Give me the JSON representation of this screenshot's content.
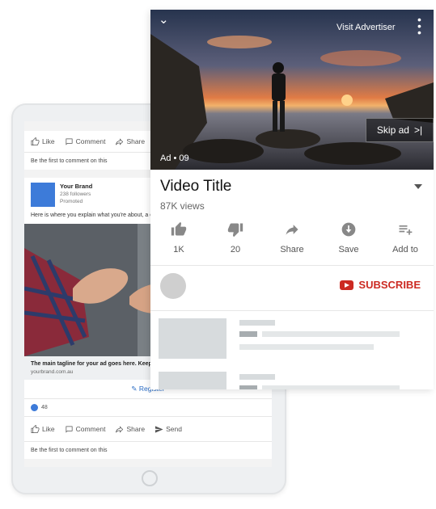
{
  "linkedin": {
    "actions": [
      {
        "icon": "thumbs-up-icon",
        "label": "Like"
      },
      {
        "icon": "comment-icon",
        "label": "Comment"
      },
      {
        "icon": "share-icon",
        "label": "Share"
      }
    ],
    "actions_bottom": [
      {
        "icon": "thumbs-up-icon",
        "label": "Like"
      },
      {
        "icon": "comment-icon",
        "label": "Comment"
      },
      {
        "icon": "share-icon",
        "label": "Share"
      },
      {
        "icon": "send-icon",
        "label": "Send"
      }
    ],
    "first_comment_note": "Be the first to comment on this",
    "brand_name": "Your Brand",
    "followers": "238 followers",
    "promoted": "Promoted",
    "post_text": "Here is where you explain what you're about, a entice your potential clients",
    "tagline": "The main tagline for your ad goes here. Keep",
    "url": "yourbrand.com.au",
    "register": "Register",
    "likes_count": "48",
    "brand_color": "#3d7bd9"
  },
  "youtube": {
    "visit_advertiser": "Visit Advertiser",
    "ad_label": "Ad • 09",
    "skip_label": "Skip ad",
    "skip_glyph": ">|",
    "video_title": "Video Title",
    "views": "87K views",
    "actions": [
      {
        "icon": "thumbs-up-icon",
        "label": "1K"
      },
      {
        "icon": "thumbs-down-icon",
        "label": "20"
      },
      {
        "icon": "share-icon",
        "label": "Share"
      },
      {
        "icon": "download-icon",
        "label": "Save"
      },
      {
        "icon": "playlist-add-icon",
        "label": "Add to"
      }
    ],
    "subscribe": "SUBSCRIBE",
    "subscribe_color": "#cc2a22"
  }
}
